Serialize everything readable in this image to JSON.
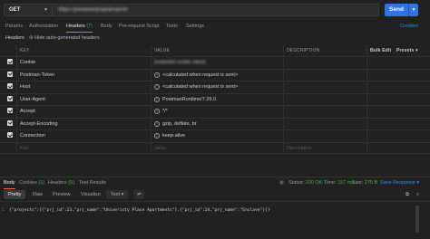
{
  "request": {
    "method": "GET",
    "url": "https://[redacted]/api/projects",
    "send_label": "Send"
  },
  "tabs": [
    {
      "label": "Params"
    },
    {
      "label": "Authorization"
    },
    {
      "label": "Headers",
      "count": "(7)"
    },
    {
      "label": "Body"
    },
    {
      "label": "Pre-request Script"
    },
    {
      "label": "Tests"
    },
    {
      "label": "Settings"
    }
  ],
  "cookies_label": "Cookies",
  "headers_section": {
    "label": "Headers",
    "hide_auto": "Hide auto-generated headers"
  },
  "table": {
    "col_key": "KEY",
    "col_value": "VALUE",
    "col_desc": "DESCRIPTION",
    "bulk_edit": "Bulk Edit",
    "presets": "Presets",
    "rows": [
      {
        "key": "Cookie",
        "value": "[redacted cookie value]",
        "blurred": true
      },
      {
        "key": "Postman-Token",
        "value": "<calculated when request is sent>",
        "info": true
      },
      {
        "key": "Host",
        "value": "<calculated when request is sent>",
        "info": true
      },
      {
        "key": "User-Agent",
        "value": "PostmanRuntime/7.29.0",
        "info": true
      },
      {
        "key": "Accept",
        "value": "*/*",
        "info": true
      },
      {
        "key": "Accept-Encoding",
        "value": "gzip, deflate, br",
        "info": true
      },
      {
        "key": "Connection",
        "value": "keep-alive",
        "info": true
      }
    ],
    "placeholder": {
      "key": "Key",
      "value": "Value",
      "desc": "Description"
    }
  },
  "response": {
    "tabs": [
      {
        "label": "Body"
      },
      {
        "label": "Cookies",
        "count": "(1)"
      },
      {
        "label": "Headers",
        "count": "(5)"
      },
      {
        "label": "Test Results"
      }
    ],
    "status_label": "Status:",
    "status_value": "200 OK",
    "time_label": "Time:",
    "time_value": "157 ms",
    "size_label": "Size:",
    "size_value": "275 B",
    "save_label": "Save Response",
    "views": [
      "Pretty",
      "Raw",
      "Preview",
      "Visualize"
    ],
    "format": "Text",
    "line_number": "1",
    "body": "{\"projects\":[{\"prj_id\":23,\"prj_name\":\"Univeristy Place Apartments\"},{\"prj_id\":24,\"prj_name\":\"Enclave\"}]}"
  },
  "colors": {
    "accent": "#f26b3a",
    "send": "#2f74e0",
    "status_ok": "#4caf50",
    "link": "#2f8cf0"
  }
}
